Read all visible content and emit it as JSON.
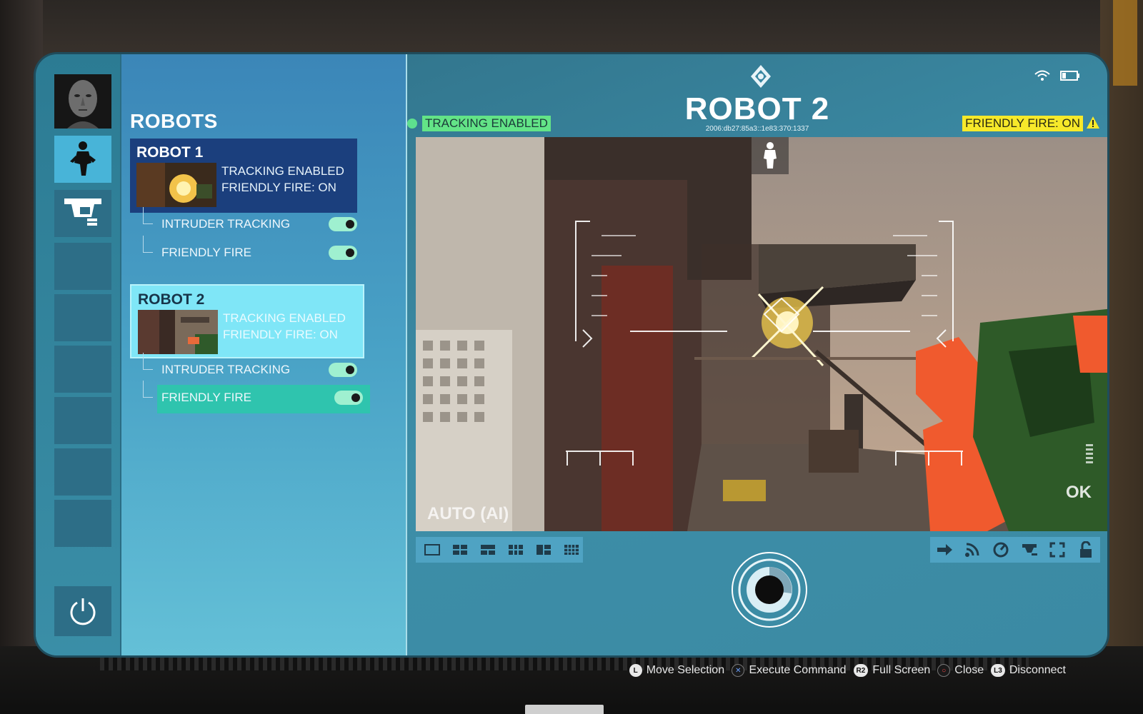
{
  "sidebar": {
    "icons": [
      "avatar-portrait",
      "robot-icon",
      "turret-icon",
      "power-icon"
    ]
  },
  "list": {
    "heading": "ROBOTS",
    "robots": [
      {
        "name": "ROBOT 1",
        "status_tracking": "TRACKING ENABLED",
        "status_ff": "FRIENDLY FIRE: ON",
        "options": [
          {
            "label": "INTRUDER TRACKING",
            "on": true
          },
          {
            "label": "FRIENDLY FIRE",
            "on": true
          }
        ]
      },
      {
        "name": "ROBOT 2",
        "status_tracking": "TRACKING ENABLED",
        "status_ff": "FRIENDLY FIRE: ON",
        "options": [
          {
            "label": "INTRUDER TRACKING",
            "on": true
          },
          {
            "label": "FRIENDLY FIRE",
            "on": true
          }
        ]
      }
    ]
  },
  "main": {
    "title": "ROBOT 2",
    "address": "2006:db27:85a3::1e83:370:1337",
    "tracking_badge": "TRACKING ENABLED",
    "friendly_fire_badge": "FRIENDLY FIRE: ON",
    "feed_mode": "AUTO (AI)",
    "feed_status": "OK"
  },
  "hints": [
    {
      "button": "L",
      "label": "Move Selection"
    },
    {
      "button": "✕",
      "label": "Execute Command"
    },
    {
      "button": "R2",
      "label": "Full Screen"
    },
    {
      "button": "○",
      "label": "Close"
    },
    {
      "button": "L3",
      "label": "Disconnect"
    }
  ],
  "colors": {
    "tracking_green": "#63e487",
    "warning_yellow": "#f7e92a",
    "selected_card": "#7fe6f7",
    "selected_option": "#2fc4ae"
  }
}
